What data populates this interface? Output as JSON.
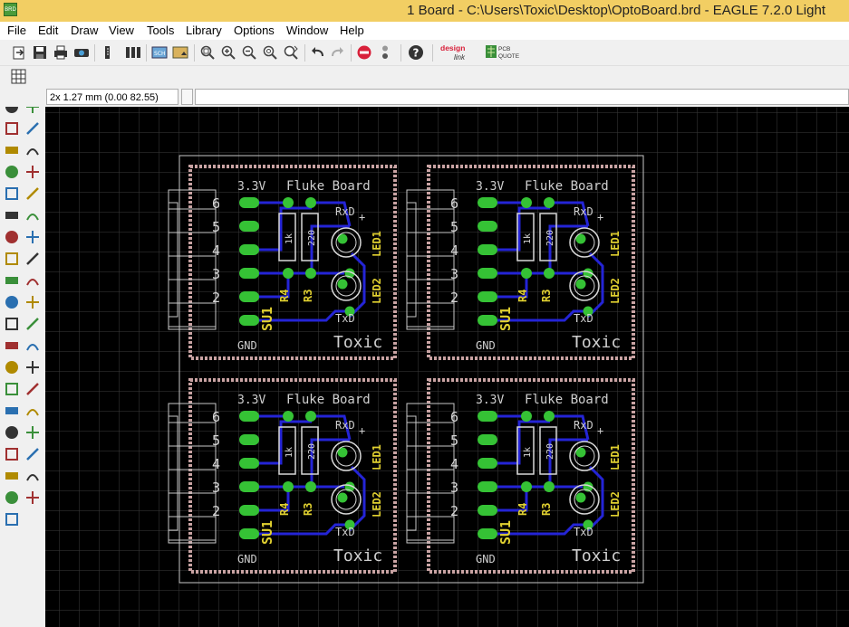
{
  "window": {
    "title": "1 Board - C:\\Users\\Toxic\\Desktop\\OptoBoard.brd - EAGLE 7.2.0 Light",
    "app_icon": "BRD"
  },
  "menu": [
    "File",
    "Edit",
    "Draw",
    "View",
    "Tools",
    "Library",
    "Options",
    "Window",
    "Help"
  ],
  "toolbar": {
    "icons": [
      "open-icon",
      "save-icon",
      "print-icon",
      "cam-icon",
      "script-icon",
      "ulp-icon",
      "schematic-icon",
      "board-icon",
      "zoom-fit-icon",
      "zoom-in-icon",
      "zoom-out-icon",
      "zoom-redraw-icon",
      "zoom-select-icon",
      "undo-icon",
      "redo-icon",
      "stop-icon",
      "go-icon",
      "help-icon",
      "designlink-icon",
      "pcb-quote-icon"
    ],
    "designlink_text": [
      "design",
      "link"
    ],
    "pcbquote_text": [
      "PCB",
      "QUOTE"
    ]
  },
  "command": {
    "coordinates": "2x 1.27 mm (0.00 82.55)",
    "input_value": ""
  },
  "side_tools": [
    "info",
    "show",
    "display",
    "mark",
    "move",
    "copy",
    "mirror",
    "rotate",
    "group",
    "change",
    "paste",
    "delete",
    "add",
    "replace",
    "lock",
    "name",
    "value",
    "smash",
    "miter",
    "split",
    "optimize",
    "route",
    "ripup",
    "wire",
    "text",
    "circle",
    "arc",
    "rect",
    "polygon",
    "via",
    "signal",
    "hole",
    "attribute",
    "dimension",
    "ratsnest",
    "auto",
    "erc",
    "drc",
    "errors"
  ],
  "board": {
    "headers": [
      "6",
      "5",
      "4",
      "3",
      "2"
    ],
    "title": "Fluke Board",
    "voltage": "3.3V",
    "gnd": "GND",
    "brand": "Toxic",
    "su": "SU1",
    "r4": "R4",
    "r3": "R3",
    "r4_value": "1k",
    "r3_value": "220",
    "rxd": "RxD",
    "txd": "TxD",
    "led1": "LED1",
    "led2": "LED2",
    "plus": "+"
  }
}
